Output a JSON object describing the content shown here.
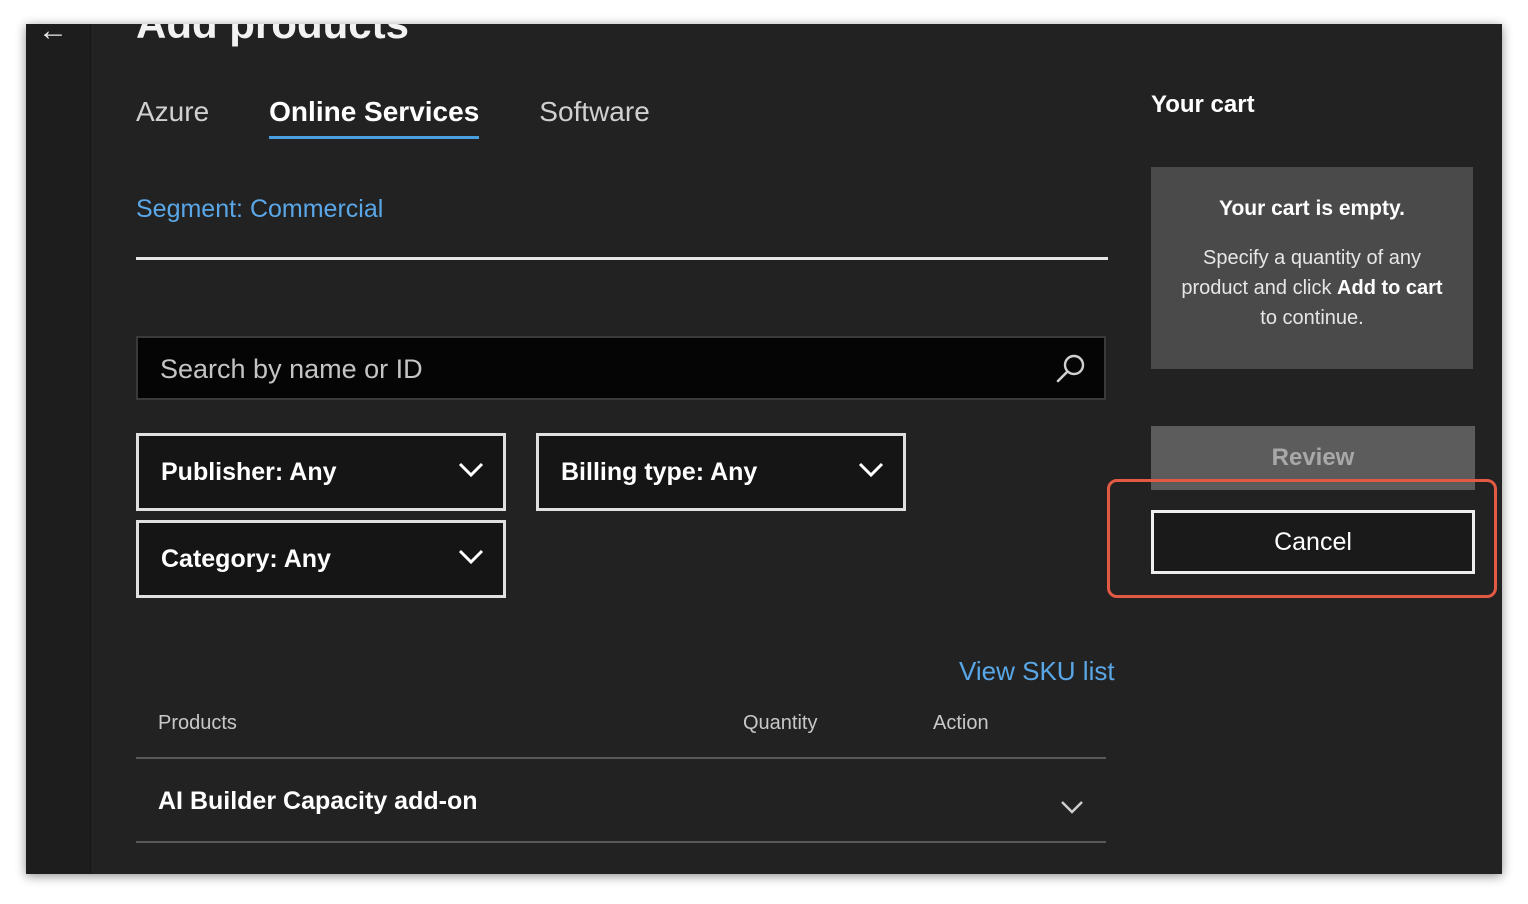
{
  "header": {
    "back_icon": "back-arrow-icon",
    "title": "Add products"
  },
  "tabs": [
    {
      "label": "Azure",
      "active": false
    },
    {
      "label": "Online Services",
      "active": true
    },
    {
      "label": "Software",
      "active": false
    }
  ],
  "segment": {
    "label": "Segment: Commercial"
  },
  "search": {
    "placeholder": "Search by name or ID",
    "value": "",
    "icon": "search-icon"
  },
  "filters": {
    "publisher": "Publisher: Any",
    "billing_type": "Billing type: Any",
    "category": "Category: Any"
  },
  "links": {
    "view_sku": "View SKU list"
  },
  "table": {
    "headers": {
      "products": "Products",
      "quantity": "Quantity",
      "action": "Action"
    },
    "rows": [
      {
        "name": "AI Builder Capacity add-on"
      }
    ]
  },
  "cart": {
    "title": "Your cart",
    "empty_title": "Your cart is empty.",
    "desc_prefix": "Specify a quantity of any product and click ",
    "desc_bold": "Add to cart",
    "desc_suffix": " to continue.",
    "review_label": "Review",
    "cancel_label": "Cancel"
  },
  "colors": {
    "accent": "#4a9fe0",
    "link": "#5aa7e8",
    "highlight": "#e25a44",
    "background": "#222222"
  }
}
